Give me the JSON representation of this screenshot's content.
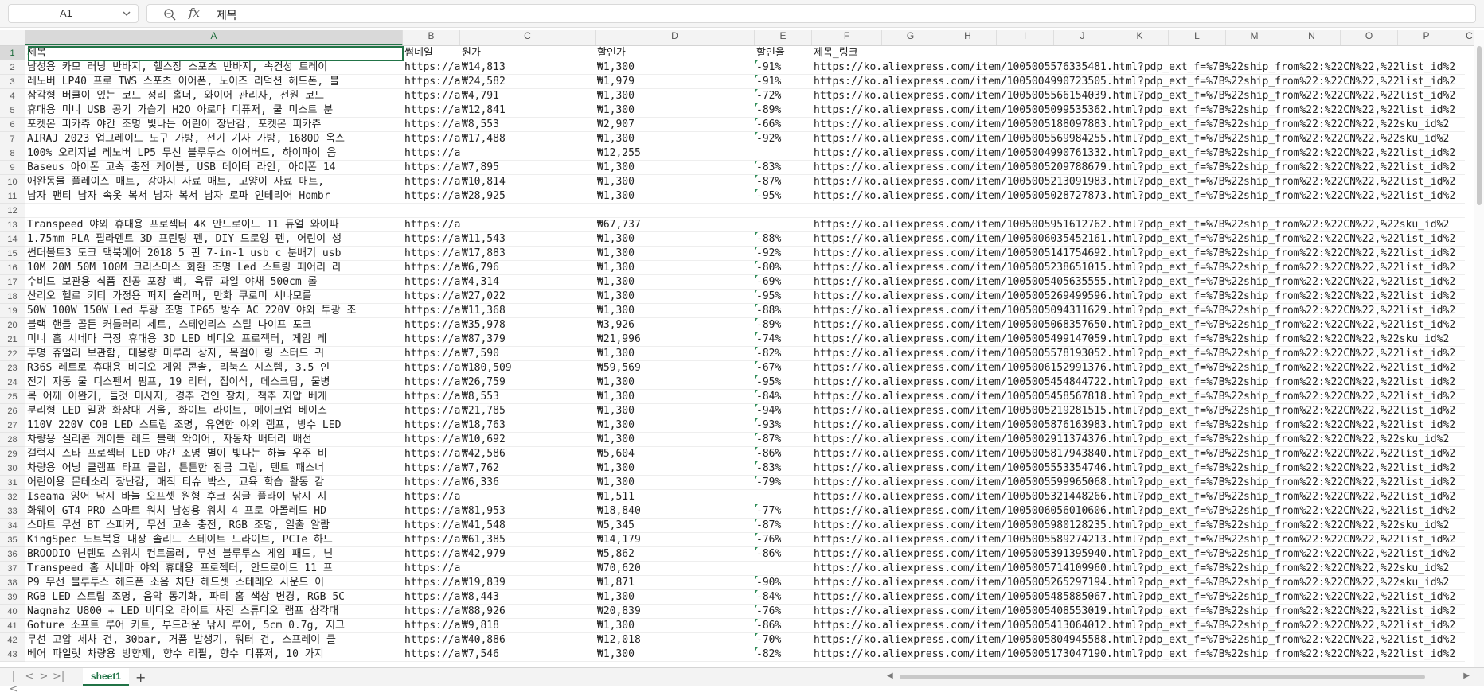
{
  "name_box": {
    "ref": "A1"
  },
  "formula_bar": {
    "fx_label": "fx",
    "value": "제목"
  },
  "columns": [
    "A",
    "B",
    "C",
    "D",
    "E",
    "F",
    "G",
    "H",
    "I",
    "J",
    "K",
    "L",
    "M",
    "N",
    "O",
    "P",
    "C"
  ],
  "header_row": {
    "A": "제목",
    "B": "썸네일",
    "C": "원가",
    "D": "할인가",
    "E": "할인율",
    "F": "제목_링크"
  },
  "rows": [
    {
      "n": 2,
      "A": "남성용 카모 러닝 반바지, 헬스장 스포츠 반바지, 속건성 트레이",
      "B": "https://a",
      "C": "₩14,813",
      "D": "₩1,300",
      "E": "-91%",
      "F": "https://ko.aliexpress.com/item/1005005576335481.html?pdp_ext_f=%7B%22ship_from%22:%22CN%22,%22list_id%2"
    },
    {
      "n": 3,
      "A": "레노버 LP40 프로 TWS 스포츠 이어폰, 노이즈 리덕션 헤드폰, 블",
      "B": "https://a",
      "C": "₩24,582",
      "D": "₩1,979",
      "E": "-91%",
      "F": "https://ko.aliexpress.com/item/1005004990723505.html?pdp_ext_f=%7B%22ship_from%22:%22CN%22,%22list_id%2"
    },
    {
      "n": 4,
      "A": "삼각형 버클이 있는 코드 정리 홀더, 와이어 관리자, 전원 코드",
      "B": "https://a",
      "C": "₩4,791",
      "D": "₩1,300",
      "E": "-72%",
      "F": "https://ko.aliexpress.com/item/1005005566154039.html?pdp_ext_f=%7B%22ship_from%22:%22CN%22,%22list_id%2"
    },
    {
      "n": 5,
      "A": "휴대용 미니 USB 공기 가습기 H2O 아로마 디퓨저, 쿨 미스트 분",
      "B": "https://a",
      "C": "₩12,841",
      "D": "₩1,300",
      "E": "-89%",
      "F": "https://ko.aliexpress.com/item/1005005099535362.html?pdp_ext_f=%7B%22ship_from%22:%22CN%22,%22list_id%2"
    },
    {
      "n": 6,
      "A": "포켓몬 피카츄 야간 조명 빛나는 어린이 장난감, 포켓몬 피카츄",
      "B": "https://a",
      "C": "₩8,553",
      "D": "₩2,907",
      "E": "-66%",
      "F": "https://ko.aliexpress.com/item/1005005188097883.html?pdp_ext_f=%7B%22ship_from%22:%22CN%22,%22sku_id%2"
    },
    {
      "n": 7,
      "A": "AIRAJ 2023 업그레이드 도구 가방, 전기 기사 가방, 1680D 옥스",
      "B": "https://a",
      "C": "₩17,488",
      "D": "₩1,300",
      "E": "-92%",
      "F": "https://ko.aliexpress.com/item/1005005569984255.html?pdp_ext_f=%7B%22ship_from%22:%22CN%22,%22sku_id%2"
    },
    {
      "n": 8,
      "A": "100% 오리지널 레노버 LP5 무선 블루투스 이어버드, 하이파이 음",
      "B": "https://a",
      "C": "",
      "D": "₩12,255",
      "E": "",
      "F": "https://ko.aliexpress.com/item/1005004990761332.html?pdp_ext_f=%7B%22ship_from%22:%22CN%22,%22list_id%2"
    },
    {
      "n": 9,
      "A": "Baseus 아이폰 고속 충전 케이블, USB 데이터 라인, 아이폰 14",
      "B": "https://a",
      "C": "₩7,895",
      "D": "₩1,300",
      "E": "-83%",
      "F": "https://ko.aliexpress.com/item/1005005209788679.html?pdp_ext_f=%7B%22ship_from%22:%22CN%22,%22list_id%2"
    },
    {
      "n": 10,
      "A": "애완동물 플레이스 매트, 강아지 사료 매트, 고양이 사료 매트,",
      "B": "https://a",
      "C": "₩10,814",
      "D": "₩1,300",
      "E": "-87%",
      "F": "https://ko.aliexpress.com/item/1005005213091983.html?pdp_ext_f=%7B%22ship_from%22:%22CN%22,%22list_id%2"
    },
    {
      "n": 11,
      "A": "남자 팬티 남자 속옷 복서 남자 복서 남자 로파 인테리어 Hombr",
      "B": "https://a",
      "C": "₩28,925",
      "D": "₩1,300",
      "E": "-95%",
      "F": "https://ko.aliexpress.com/item/1005005028727873.html?pdp_ext_f=%7B%22ship_from%22:%22CN%22,%22list_id%2"
    },
    {
      "n": 12,
      "A": "",
      "B": "",
      "C": "",
      "D": "",
      "E": "",
      "F": ""
    },
    {
      "n": 13,
      "A": "Transpeed 야외 휴대용 프로젝터 4K 안드로이드 11 듀얼 와이파",
      "B": "https://a",
      "C": "",
      "D": "₩67,737",
      "E": "",
      "F": "https://ko.aliexpress.com/item/1005005951612762.html?pdp_ext_f=%7B%22ship_from%22:%22CN%22,%22sku_id%2"
    },
    {
      "n": 14,
      "A": "1.75mm PLA 필라멘트 3D 프린팅 펜, DIY 드로잉 펜, 어린이 생",
      "B": "https://a",
      "C": "₩11,543",
      "D": "₩1,300",
      "E": "-88%",
      "F": "https://ko.aliexpress.com/item/1005006035452161.html?pdp_ext_f=%7B%22ship_from%22:%22CN%22,%22list_id%2"
    },
    {
      "n": 15,
      "A": "썬더볼트3 도크 맥북에어 2018 5 핀 7-in-1 usb c 분배기 usb",
      "B": "https://a",
      "C": "₩17,883",
      "D": "₩1,300",
      "E": "-92%",
      "F": "https://ko.aliexpress.com/item/1005005141754692.html?pdp_ext_f=%7B%22ship_from%22:%22CN%22,%22list_id%2"
    },
    {
      "n": 16,
      "A": "10M 20M 50M 100M 크리스마스 화환 조명 Led 스트링 패어리 라",
      "B": "https://a",
      "C": "₩6,796",
      "D": "₩1,300",
      "E": "-80%",
      "F": "https://ko.aliexpress.com/item/1005005238651015.html?pdp_ext_f=%7B%22ship_from%22:%22CN%22,%22list_id%2"
    },
    {
      "n": 17,
      "A": "수비드 보관용 식품 진공 포장 백, 육류 과일 야채 500cm 롤",
      "B": "https://a",
      "C": "₩4,314",
      "D": "₩1,300",
      "E": "-69%",
      "F": "https://ko.aliexpress.com/item/1005005405635555.html?pdp_ext_f=%7B%22ship_from%22:%22CN%22,%22list_id%2"
    },
    {
      "n": 18,
      "A": "산리오 헬로 키티 가정용 퍼지 슬리퍼, 만화 쿠로미 시나모롤",
      "B": "https://a",
      "C": "₩27,022",
      "D": "₩1,300",
      "E": "-95%",
      "F": "https://ko.aliexpress.com/item/1005005269499596.html?pdp_ext_f=%7B%22ship_from%22:%22CN%22,%22list_id%2"
    },
    {
      "n": 19,
      "A": "50W 100W 150W Led 투광 조명 IP65 방수 AC 220V 야외 투광 조",
      "B": "https://a",
      "C": "₩11,368",
      "D": "₩1,300",
      "E": "-88%",
      "F": "https://ko.aliexpress.com/item/1005005094311629.html?pdp_ext_f=%7B%22ship_from%22:%22CN%22,%22list_id%2"
    },
    {
      "n": 20,
      "A": "블랙 핸들 골든 커틀러리 세트, 스테인리스 스틸 나이프 포크",
      "B": "https://a",
      "C": "₩35,978",
      "D": "₩3,926",
      "E": "-89%",
      "F": "https://ko.aliexpress.com/item/1005005068357650.html?pdp_ext_f=%7B%22ship_from%22:%22CN%22,%22list_id%2"
    },
    {
      "n": 21,
      "A": "미니 홈 시네마 극장 휴대용 3D LED 비디오 프로젝터, 게임 레",
      "B": "https://a",
      "C": "₩87,379",
      "D": "₩21,996",
      "E": "-74%",
      "F": "https://ko.aliexpress.com/item/1005005499147059.html?pdp_ext_f=%7B%22ship_from%22:%22CN%22,%22sku_id%2"
    },
    {
      "n": 22,
      "A": "투명 쥬얼리 보관함, 대용량 마루리 상자, 목걸이 링 스터드 귀",
      "B": "https://a",
      "C": "₩7,590",
      "D": "₩1,300",
      "E": "-82%",
      "F": "https://ko.aliexpress.com/item/1005005578193052.html?pdp_ext_f=%7B%22ship_from%22:%22CN%22,%22list_id%2"
    },
    {
      "n": 23,
      "A": "R36S 레트로 휴대용 비디오 게임 콘솔, 리눅스 시스템, 3.5 인",
      "B": "https://a",
      "C": "₩180,509",
      "D": "₩59,569",
      "E": "-67%",
      "F": "https://ko.aliexpress.com/item/1005006152991376.html?pdp_ext_f=%7B%22ship_from%22:%22CN%22,%22list_id%2"
    },
    {
      "n": 24,
      "A": "전기 자동 물 디스펜서 펌프, 19 리터, 접이식, 데스크탑, 물병",
      "B": "https://a",
      "C": "₩26,759",
      "D": "₩1,300",
      "E": "-95%",
      "F": "https://ko.aliexpress.com/item/1005005454844722.html?pdp_ext_f=%7B%22ship_from%22:%22CN%22,%22list_id%2"
    },
    {
      "n": 25,
      "A": "목 어깨 이완기, 들것 마사지, 경추 견인 장치, 척추 지압 베개",
      "B": "https://a",
      "C": "₩8,553",
      "D": "₩1,300",
      "E": "-84%",
      "F": "https://ko.aliexpress.com/item/1005005458567818.html?pdp_ext_f=%7B%22ship_from%22:%22CN%22,%22list_id%2"
    },
    {
      "n": 26,
      "A": "분리형 LED 일광 화장대 거울, 화이트 라이트, 메이크업 베이스",
      "B": "https://a",
      "C": "₩21,785",
      "D": "₩1,300",
      "E": "-94%",
      "F": "https://ko.aliexpress.com/item/1005005219281515.html?pdp_ext_f=%7B%22ship_from%22:%22CN%22,%22list_id%2"
    },
    {
      "n": 27,
      "A": "110V 220V COB LED 스트립 조명, 유연한 야외 램프, 방수 LED",
      "B": "https://a",
      "C": "₩18,763",
      "D": "₩1,300",
      "E": "-93%",
      "F": "https://ko.aliexpress.com/item/1005005876163983.html?pdp_ext_f=%7B%22ship_from%22:%22CN%22,%22list_id%2"
    },
    {
      "n": 28,
      "A": "차량용 실리콘 케이블 레드 블랙 와이어, 자동차 배터리 배선",
      "B": "https://a",
      "C": "₩10,692",
      "D": "₩1,300",
      "E": "-87%",
      "F": "https://ko.aliexpress.com/item/1005002911374376.html?pdp_ext_f=%7B%22ship_from%22:%22CN%22,%22sku_id%2"
    },
    {
      "n": 29,
      "A": "갤럭시 스타 프로젝터 LED 야간 조명 별이 빛나는 하늘 우주 비",
      "B": "https://a",
      "C": "₩42,586",
      "D": "₩5,604",
      "E": "-86%",
      "F": "https://ko.aliexpress.com/item/1005005817943840.html?pdp_ext_f=%7B%22ship_from%22:%22CN%22,%22list_id%2"
    },
    {
      "n": 30,
      "A": "차량용 어닝 클램프 타프 클립, 튼튼한 잠금 그립, 텐트 패스너",
      "B": "https://a",
      "C": "₩7,762",
      "D": "₩1,300",
      "E": "-83%",
      "F": "https://ko.aliexpress.com/item/1005005553354746.html?pdp_ext_f=%7B%22ship_from%22:%22CN%22,%22list_id%2"
    },
    {
      "n": 31,
      "A": "어린이용 몬테소리 장난감, 매직 티슈 박스, 교육 학습 활동 감",
      "B": "https://a",
      "C": "₩6,336",
      "D": "₩1,300",
      "E": "-79%",
      "F": "https://ko.aliexpress.com/item/1005005599965068.html?pdp_ext_f=%7B%22ship_from%22:%22CN%22,%22list_id%2"
    },
    {
      "n": 32,
      "A": "Iseama 잉어 낚시 바늘 오프셋 원형 후크 싱글 플라이 낚시 지",
      "B": "https://a",
      "C": "",
      "D": "₩1,511",
      "E": "",
      "F": "https://ko.aliexpress.com/item/1005005321448266.html?pdp_ext_f=%7B%22ship_from%22:%22CN%22,%22list_id%2"
    },
    {
      "n": 33,
      "A": "화웨이 GT4 PRO 스마트 워치 남성용 워치 4 프로 아몰레드 HD",
      "B": "https://a",
      "C": "₩81,953",
      "D": "₩18,840",
      "E": "-77%",
      "F": "https://ko.aliexpress.com/item/1005006056010606.html?pdp_ext_f=%7B%22ship_from%22:%22CN%22,%22list_id%2"
    },
    {
      "n": 34,
      "A": "스마트 무선 BT 스피커, 무선 고속 충전, RGB 조명, 일출 알람",
      "B": "https://a",
      "C": "₩41,548",
      "D": "₩5,345",
      "E": "-87%",
      "F": "https://ko.aliexpress.com/item/1005005980128235.html?pdp_ext_f=%7B%22ship_from%22:%22CN%22,%22sku_id%2"
    },
    {
      "n": 35,
      "A": "KingSpec 노트북용 내장 솔리드 스테이트 드라이브, PCIe 하드",
      "B": "https://a",
      "C": "₩61,385",
      "D": "₩14,179",
      "E": "-76%",
      "F": "https://ko.aliexpress.com/item/1005005589274213.html?pdp_ext_f=%7B%22ship_from%22:%22CN%22,%22list_id%2"
    },
    {
      "n": 36,
      "A": "BROODIO 닌텐도 스위치 컨트롤러, 무선 블루투스 게임 패드, 닌",
      "B": "https://a",
      "C": "₩42,979",
      "D": "₩5,862",
      "E": "-86%",
      "F": "https://ko.aliexpress.com/item/1005005391395940.html?pdp_ext_f=%7B%22ship_from%22:%22CN%22,%22list_id%2"
    },
    {
      "n": 37,
      "A": "Transpeed 홈 시네마 야외 휴대용 프로젝터, 안드로이드 11 프",
      "B": "https://a",
      "C": "",
      "D": "₩70,620",
      "E": "",
      "F": "https://ko.aliexpress.com/item/1005005714109960.html?pdp_ext_f=%7B%22ship_from%22:%22CN%22,%22sku_id%2"
    },
    {
      "n": 38,
      "A": "P9 무선 블루투스 헤드폰 소음 차단 헤드셋 스테레오 사운드 이",
      "B": "https://a",
      "C": "₩19,839",
      "D": "₩1,871",
      "E": "-90%",
      "F": "https://ko.aliexpress.com/item/1005005265297194.html?pdp_ext_f=%7B%22ship_from%22:%22CN%22,%22sku_id%2"
    },
    {
      "n": 39,
      "A": "RGB LED 스트립 조명, 음악 동기화, 파티 홈 색상 변경, RGB 5C",
      "B": "https://a",
      "C": "₩8,443",
      "D": "₩1,300",
      "E": "-84%",
      "F": "https://ko.aliexpress.com/item/1005005485885067.html?pdp_ext_f=%7B%22ship_from%22:%22CN%22,%22list_id%2"
    },
    {
      "n": 40,
      "A": "Nagnahz U800 + LED 비디오 라이트 사진 스튜디오 램프 삼각대",
      "B": "https://a",
      "C": "₩88,926",
      "D": "₩20,839",
      "E": "-76%",
      "F": "https://ko.aliexpress.com/item/1005005408553019.html?pdp_ext_f=%7B%22ship_from%22:%22CN%22,%22list_id%2"
    },
    {
      "n": 41,
      "A": "Goture 소프트 루어 키트, 부드러운 낚시 루어, 5cm 0.7g, 지그",
      "B": "https://a",
      "C": "₩9,818",
      "D": "₩1,300",
      "E": "-86%",
      "F": "https://ko.aliexpress.com/item/1005005413064012.html?pdp_ext_f=%7B%22ship_from%22:%22CN%22,%22list_id%2"
    },
    {
      "n": 42,
      "A": "무선 고압 세차 건, 30bar, 거품 발생기, 워터 건, 스프레이 클",
      "B": "https://a",
      "C": "₩40,886",
      "D": "₩12,018",
      "E": "-70%",
      "F": "https://ko.aliexpress.com/item/1005005804945588.html?pdp_ext_f=%7B%22ship_from%22:%22CN%22,%22list_id%2"
    },
    {
      "n": 43,
      "A": "베어 파일럿 차량용 방향제, 향수 리필, 향수 디퓨저, 10 가지",
      "B": "https://a",
      "C": "₩7,546",
      "D": "₩1,300",
      "E": "-82%",
      "F": "https://ko.aliexpress.com/item/1005005173047190.html?pdp_ext_f=%7B%22ship_from%22:%22CN%22,%22list_id%2"
    }
  ],
  "sheet_tabs": [
    {
      "label": "sheet1",
      "active": true
    }
  ],
  "colors": {
    "accent": "#217346",
    "header_bg": "#f3f3f3",
    "grid": "#eeeeee",
    "indicator": "#2e8b57"
  },
  "icons": [
    "chevron-down-icon",
    "zoom-icon",
    "fx-icon",
    "first-sheet-icon",
    "prev-sheet-icon",
    "next-sheet-icon",
    "last-sheet-icon",
    "add-sheet-icon"
  ]
}
